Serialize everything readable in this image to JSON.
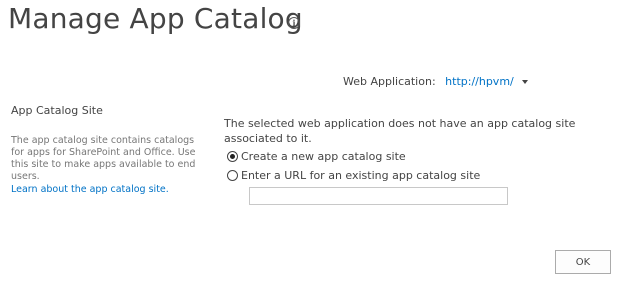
{
  "page": {
    "title": "Manage App Catalog",
    "info_icon": "info-icon"
  },
  "web_application": {
    "label": "Web Application:",
    "value": "http://hpvm/",
    "dropdown_icon": "chevron-down-icon"
  },
  "app_catalog_section": {
    "heading": "App Catalog Site",
    "description": "The app catalog site contains catalogs for apps for SharePoint and Office. Use this site to make apps available to end users.",
    "learn_more_link": "Learn about the app catalog site."
  },
  "main": {
    "message": "The selected web application does not have an app catalog site associated to it.",
    "options": [
      {
        "label": "Create a new app catalog site",
        "selected": true
      },
      {
        "label": "Enter a URL for an existing app catalog site",
        "selected": false
      }
    ],
    "url_input": {
      "value": "",
      "placeholder": ""
    }
  },
  "actions": {
    "ok_label": "OK"
  },
  "colors": {
    "link": "#0072c6",
    "text": "#444444",
    "muted_text": "#777777"
  }
}
